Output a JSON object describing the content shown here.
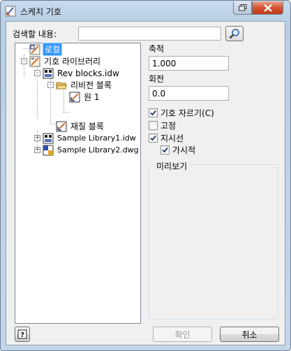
{
  "window": {
    "title": "스케치 기호",
    "restore_icon": "restore-icon",
    "close_icon": "close-x-icon"
  },
  "search": {
    "label": "검색할 내용:",
    "value": "",
    "button_icon": "magnifier-icon"
  },
  "tree": {
    "nodes": [
      {
        "label": "로컬",
        "icon": "sketch-symbol-icon",
        "selected": true
      },
      {
        "label": "기호 라이브러리",
        "icon": "sketch-symbol-icon",
        "expander": "-"
      },
      {
        "label": "Rev blocks.idw",
        "icon": "drawing-file-icon",
        "expander": "-"
      },
      {
        "label": "리비전 블록",
        "icon": "folder-open-icon",
        "expander": "-"
      },
      {
        "label": "원 1",
        "icon": "sketch-symbol-icon"
      },
      {
        "label": "재질 블록",
        "icon": "sketch-symbol-icon"
      },
      {
        "label": "Sample Library1.idw",
        "icon": "drawing-file-icon",
        "expander": "+"
      },
      {
        "label": "Sample Library2.dwg",
        "icon": "dwg-file-icon",
        "expander": "+"
      }
    ]
  },
  "properties": {
    "scale_label": "축척",
    "scale_value": "1.000",
    "rotation_label": "회전",
    "rotation_value": "0.0",
    "checkboxes": [
      {
        "label": "기호 자르기(C)",
        "checked": true
      },
      {
        "label": "고정",
        "checked": false
      },
      {
        "label": "지시선",
        "checked": true
      },
      {
        "label": "가시적",
        "checked": true
      }
    ],
    "preview_label": "미리보기"
  },
  "buttons": {
    "help_label": "?",
    "ok_label": "확인",
    "cancel_label": "취소"
  }
}
